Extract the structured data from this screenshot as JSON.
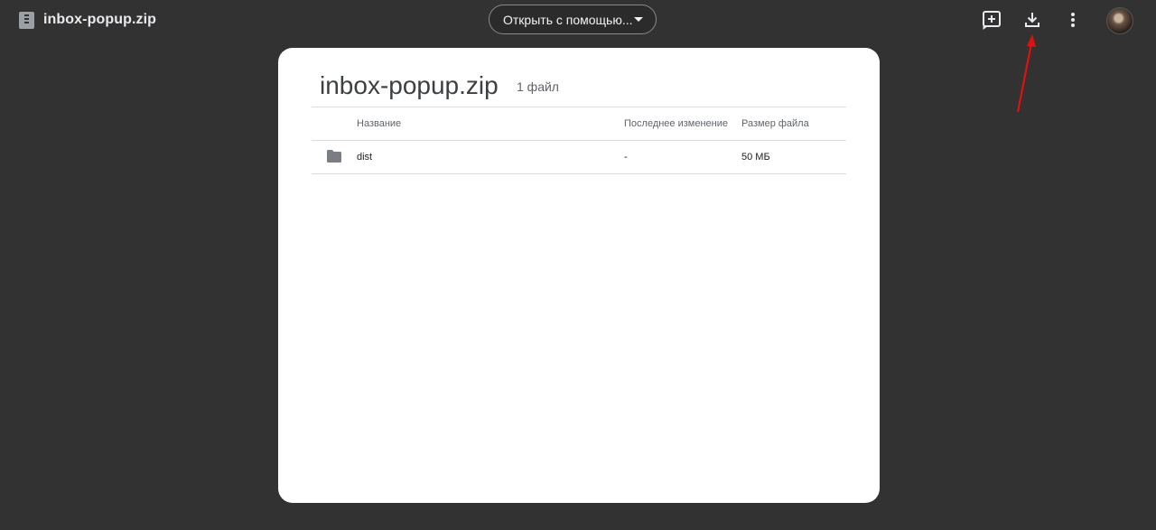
{
  "header": {
    "file_icon": "zip-file-icon",
    "title": "inbox-popup.zip",
    "open_with_label": "Открыть с помощью...",
    "icons": {
      "add_to_drive": "add-to-drive-icon",
      "download": "download-icon",
      "more": "more-vertical-icon",
      "avatar": "user-avatar"
    }
  },
  "card": {
    "title": "inbox-popup.zip",
    "file_count": "1 файл",
    "columns": {
      "name": "Название",
      "modified": "Последнее изменение",
      "size": "Размер файла"
    },
    "rows": [
      {
        "icon": "folder-icon",
        "name": "dist",
        "modified": "-",
        "size": "50 МБ"
      }
    ]
  },
  "colors": {
    "background": "#323232",
    "card": "#ffffff",
    "annotation_arrow": "#e01010"
  }
}
